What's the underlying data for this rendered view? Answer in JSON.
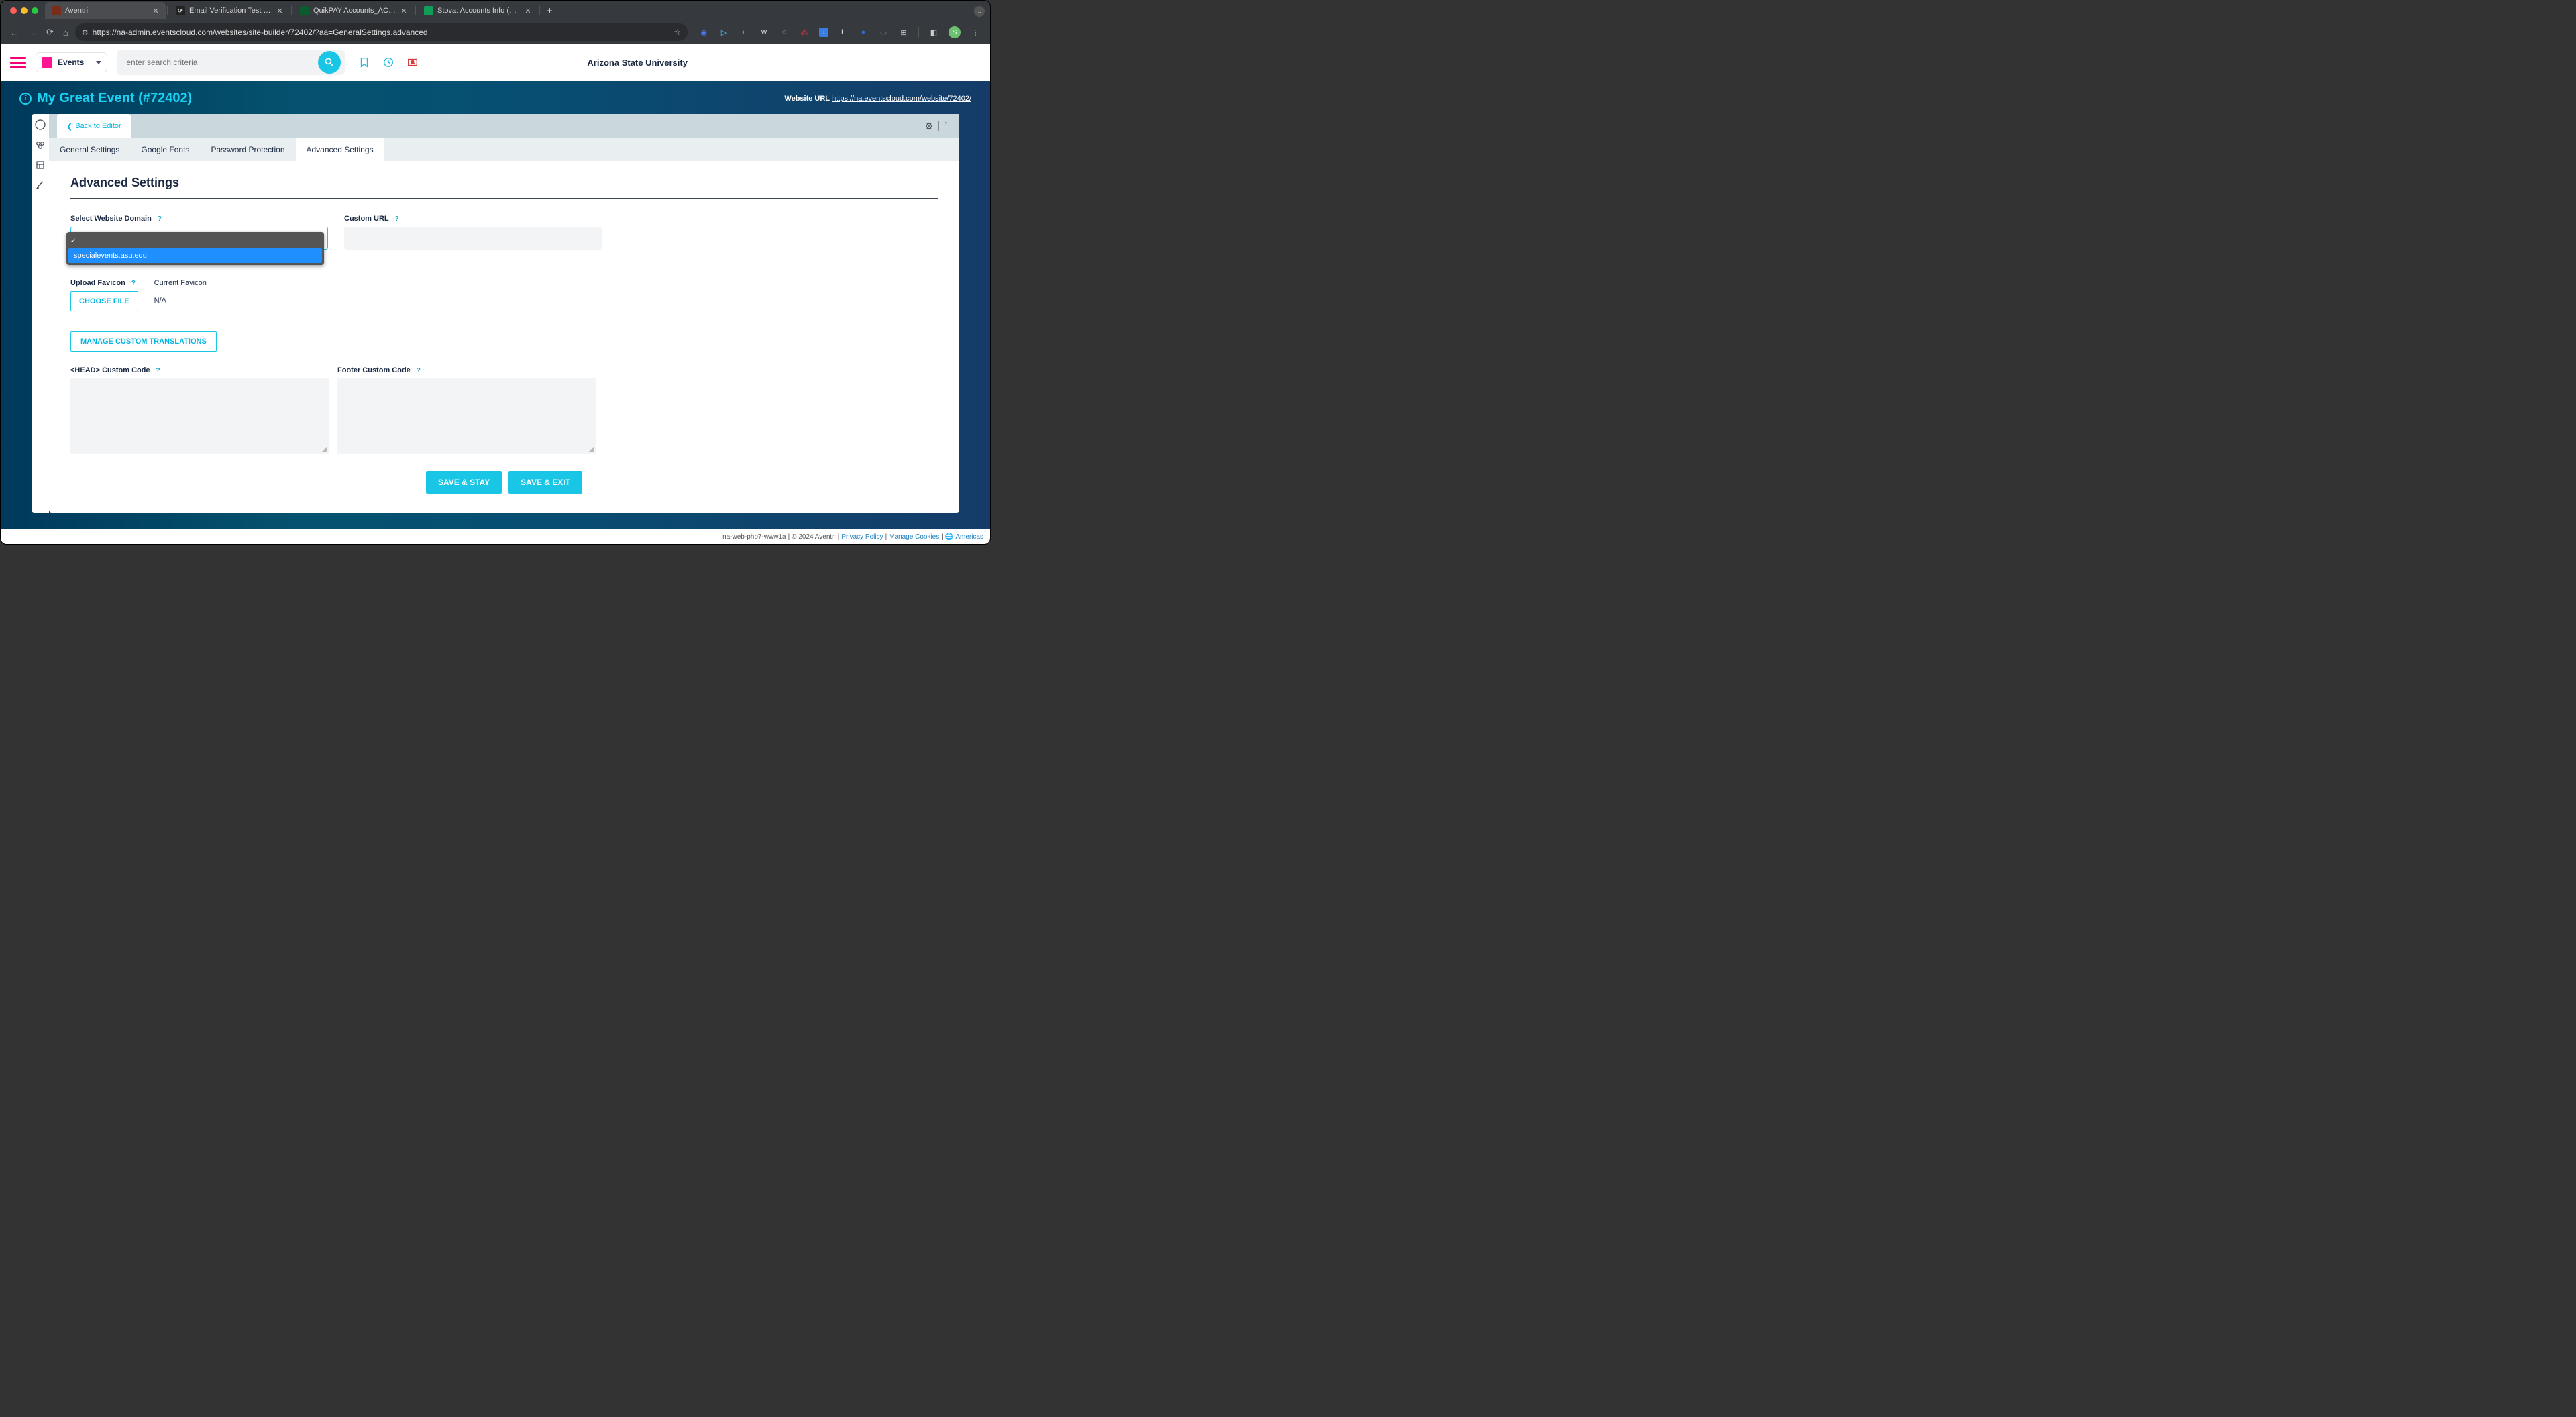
{
  "browser": {
    "tabs": [
      {
        "title": "Aventri",
        "favicon_bg": "#7a2c1a",
        "favicon_txt": ""
      },
      {
        "title": "Email Verification Test - New",
        "favicon_bg": "#222",
        "favicon_txt": ""
      },
      {
        "title": "QuikPAY Accounts_ACCT AD",
        "favicon_bg": "#0a5c2e",
        "favicon_txt": ""
      },
      {
        "title": "Stova: Accounts Info (For Acc",
        "favicon_bg": "#0f9d58",
        "favicon_txt": ""
      }
    ],
    "url": "https://na-admin.eventscloud.com/websites/site-builder/72402/?aa=GeneralSettings.advanced"
  },
  "topbar": {
    "events_label": "Events",
    "search_placeholder": "enter search criteria",
    "org_name": "Arizona State University"
  },
  "header": {
    "event_title": "My Great Event (#72402)",
    "website_url_label": "Website URL",
    "website_url": "https://na.eventscloud.com/website/72402/"
  },
  "panel": {
    "back_to_editor": "Back to Editor",
    "tabs": [
      "General Settings",
      "Google Fonts",
      "Password Protection",
      "Advanced Settings"
    ],
    "active_tab": 3,
    "section_title": "Advanced Settings"
  },
  "form": {
    "domain_label": "Select Website Domain",
    "dropdown_options": [
      "",
      "specialevents.asu.edu"
    ],
    "dropdown_selected": 1,
    "custom_url_label": "Custom URL",
    "upload_favicon_label": "Upload Favicon",
    "current_favicon_label": "Current Favicon",
    "choose_file": "CHOOSE FILE",
    "current_favicon_value": "N/A",
    "manage_translations": "MANAGE CUSTOM TRANSLATIONS",
    "head_code_label": "<HEAD> Custom Code",
    "footer_code_label": "Footer Custom Code",
    "save_stay": "SAVE & STAY",
    "save_exit": "SAVE & EXIT"
  },
  "footer": {
    "server": "na-web-php7-www1a",
    "copyright": "© 2024 Aventri",
    "privacy": "Privacy Policy",
    "cookies": "Manage Cookies",
    "region": "Americas"
  }
}
